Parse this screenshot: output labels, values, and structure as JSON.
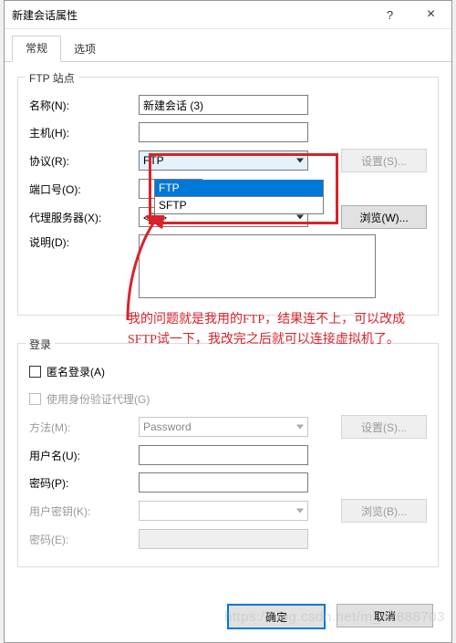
{
  "titlebar": {
    "title": "新建会话属性",
    "help": "?",
    "close": "×"
  },
  "tabs": {
    "general": "常规",
    "options": "选项"
  },
  "ftp_group": {
    "legend": "FTP 站点",
    "name_label": "名称(N):",
    "name_value": "新建会话 (3)",
    "host_label": "主机(H):",
    "host_value": "",
    "protocol_label": "协议(R):",
    "protocol_value": "FTP",
    "protocol_options": [
      "FTP",
      "SFTP"
    ],
    "settings_btn": "设置(S)...",
    "port_label": "端口号(O):",
    "port_value": "",
    "proxy_label": "代理服务器(X):",
    "proxy_value": "<无>",
    "browse_btn": "浏览(W)...",
    "desc_label": "说明(D):",
    "desc_value": ""
  },
  "login_group": {
    "legend": "登录",
    "anon_label": "匿名登录(A)",
    "useauth_label": "使用身份验证代理(G)",
    "method_label": "方法(M):",
    "method_value": "Password",
    "settings_btn": "设置(S)...",
    "user_label": "用户名(U):",
    "user_value": "",
    "pass_label": "密码(P):",
    "pass_value": "",
    "userkey_label": "用户密钥(K):",
    "userkey_value": "",
    "browse_btn": "浏览(B)...",
    "passphrase_label": "密码(E):",
    "passphrase_value": ""
  },
  "footer": {
    "ok": "确定",
    "cancel": "取消"
  },
  "annotation": {
    "text": "我的问题就是我用的FTP，结果连不上，可以改成SFTP试一下，我改完之后就可以连接虚拟机了。"
  },
  "watermark": "https://blog.csdn.net/m_42888703"
}
